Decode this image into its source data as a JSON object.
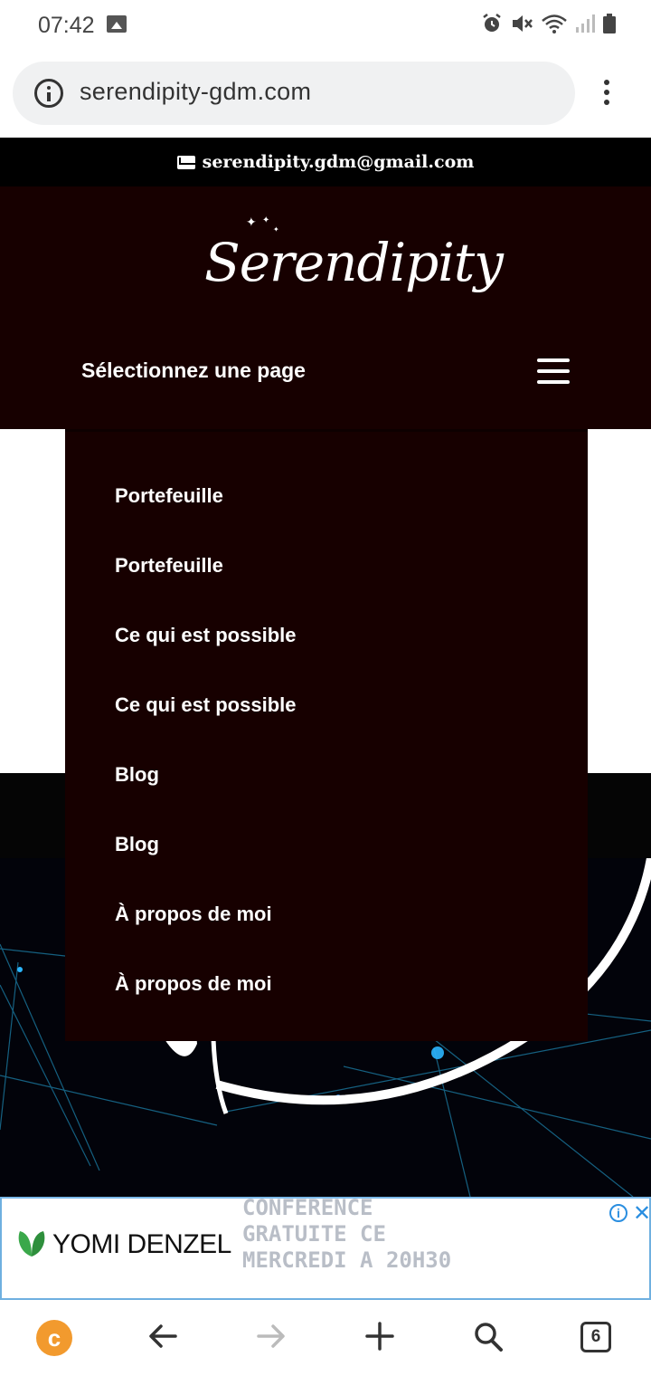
{
  "status_bar": {
    "time": "07:42"
  },
  "browser": {
    "url": "serendipity-gdm.com",
    "tab_count": "6"
  },
  "site": {
    "email": "serendipity.gdm@gmail.com",
    "logo_text": "Serendipity",
    "nav_label": "Sélectionnez une page",
    "menu_items": [
      "Portefeuille",
      "Portefeuille",
      "Ce qui est possible",
      "Ce qui est possible",
      "Blog",
      "Blog",
      "À propos de moi",
      "À propos de moi"
    ]
  },
  "ad": {
    "brand": "YOMI DENZEL",
    "line1": "CONFERENCE",
    "line2": "GRATUITE CE",
    "line3": "MERCREDI A 20H30",
    "accent_color": "#2a8ee0",
    "brand_icon_color": "#3aa84a"
  },
  "colors": {
    "header_bg": "#170000",
    "home_button": "#f29a2e"
  }
}
